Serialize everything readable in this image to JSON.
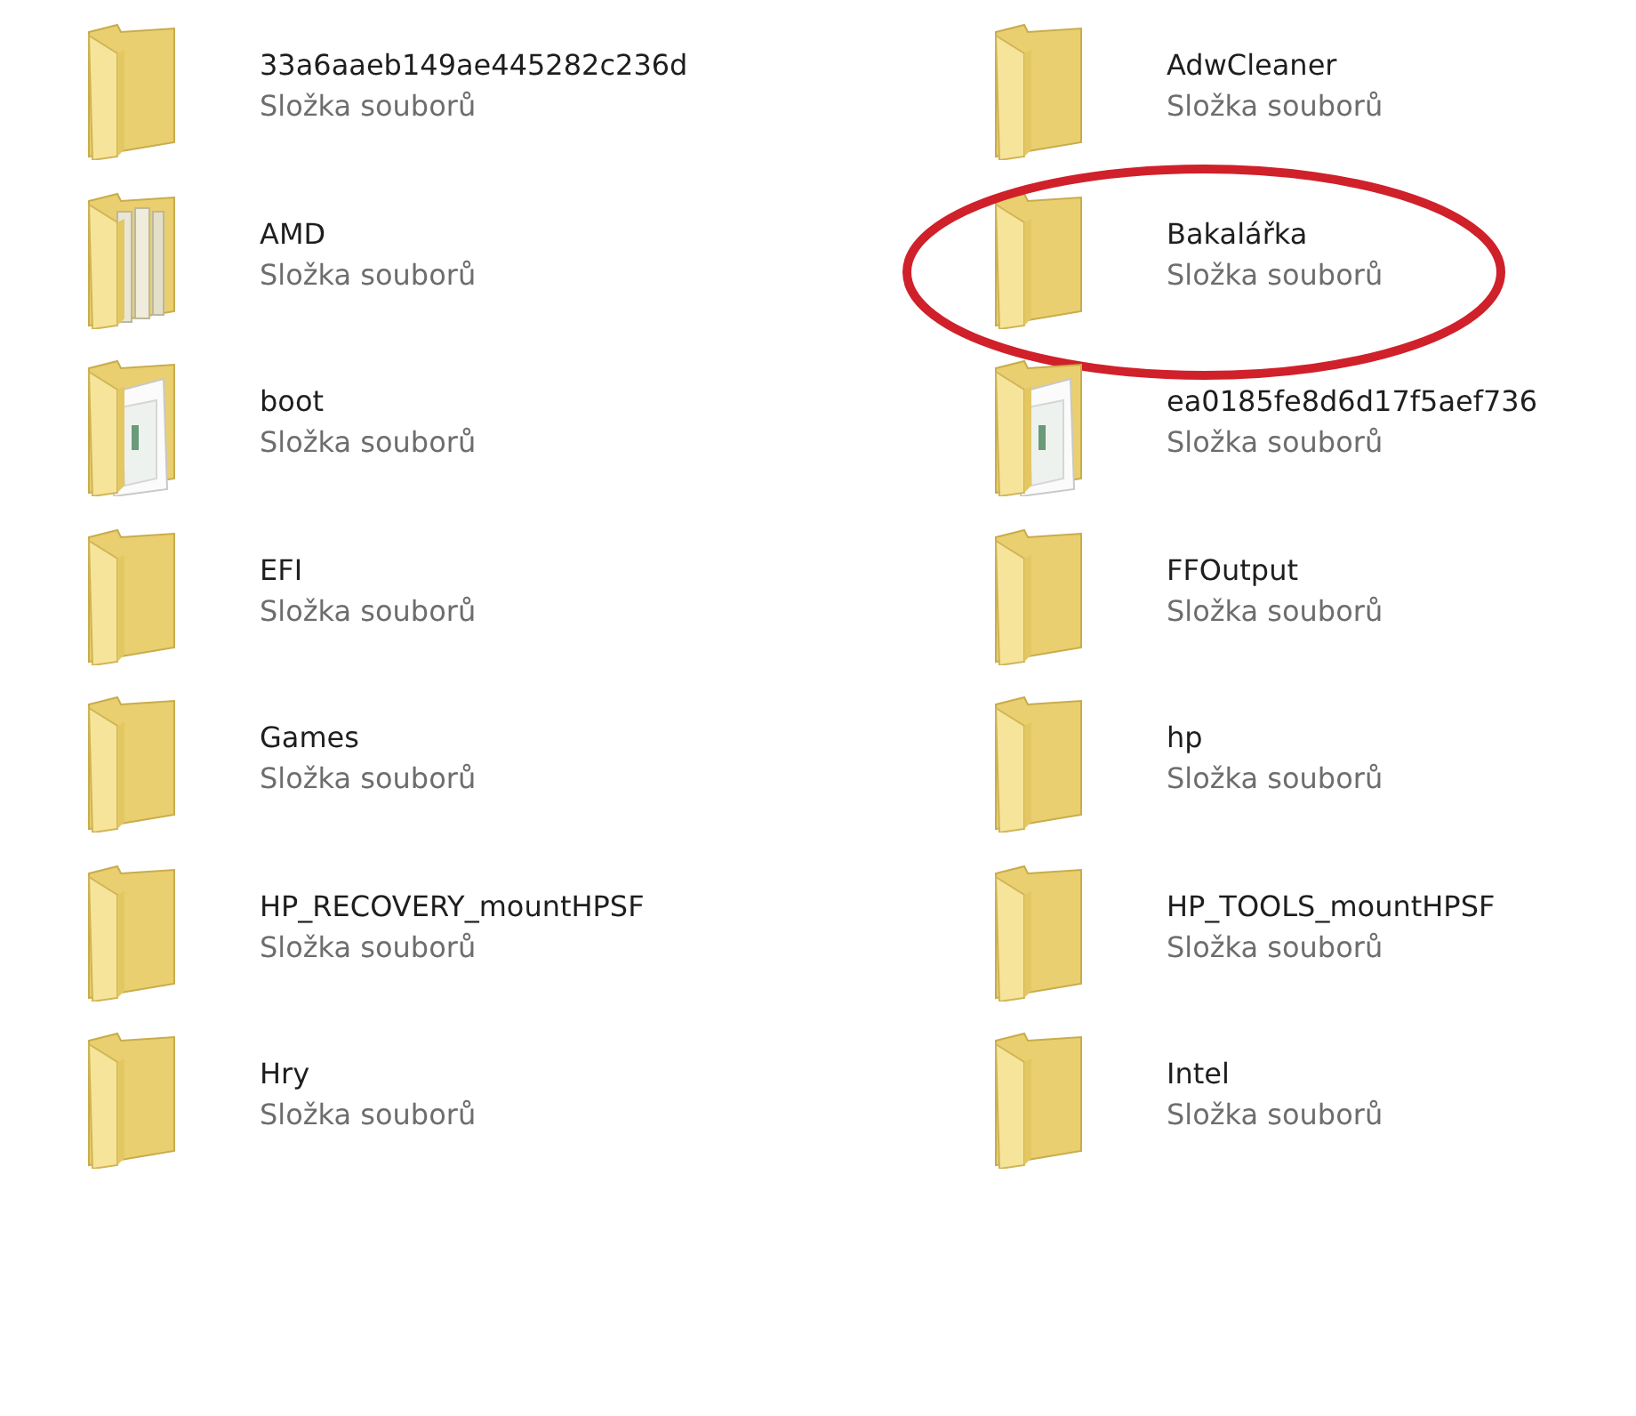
{
  "items": [
    {
      "name": "33a6aaeb149ae445282c236d",
      "type": "Složka souborů",
      "kind": "plain",
      "circled": false
    },
    {
      "name": "AdwCleaner",
      "type": "Složka souborů",
      "kind": "plain",
      "circled": false
    },
    {
      "name": "AMD",
      "type": "Složka souborů",
      "kind": "binders",
      "circled": false
    },
    {
      "name": "Bakalářka",
      "type": "Složka souborů",
      "kind": "plain",
      "circled": true
    },
    {
      "name": "boot",
      "type": "Složka souborů",
      "kind": "papers",
      "circled": false
    },
    {
      "name": "ea0185fe8d6d17f5aef736",
      "type": "Složka souborů",
      "kind": "papers",
      "circled": false
    },
    {
      "name": "EFI",
      "type": "Složka souborů",
      "kind": "plain",
      "circled": false
    },
    {
      "name": "FFOutput",
      "type": "Složka souborů",
      "kind": "plain",
      "circled": false
    },
    {
      "name": "Games",
      "type": "Složka souborů",
      "kind": "plain",
      "circled": false
    },
    {
      "name": "hp",
      "type": "Složka souborů",
      "kind": "plain",
      "circled": false
    },
    {
      "name": "HP_RECOVERY_mountHPSF",
      "type": "Složka souborů",
      "kind": "plain",
      "circled": false
    },
    {
      "name": "HP_TOOLS_mountHPSF",
      "type": "Složka souborů",
      "kind": "plain",
      "circled": false
    },
    {
      "name": "Hry",
      "type": "Složka souborů",
      "kind": "plain",
      "circled": false
    },
    {
      "name": "Intel",
      "type": "Složka souborů",
      "kind": "plain",
      "circled": false
    }
  ]
}
